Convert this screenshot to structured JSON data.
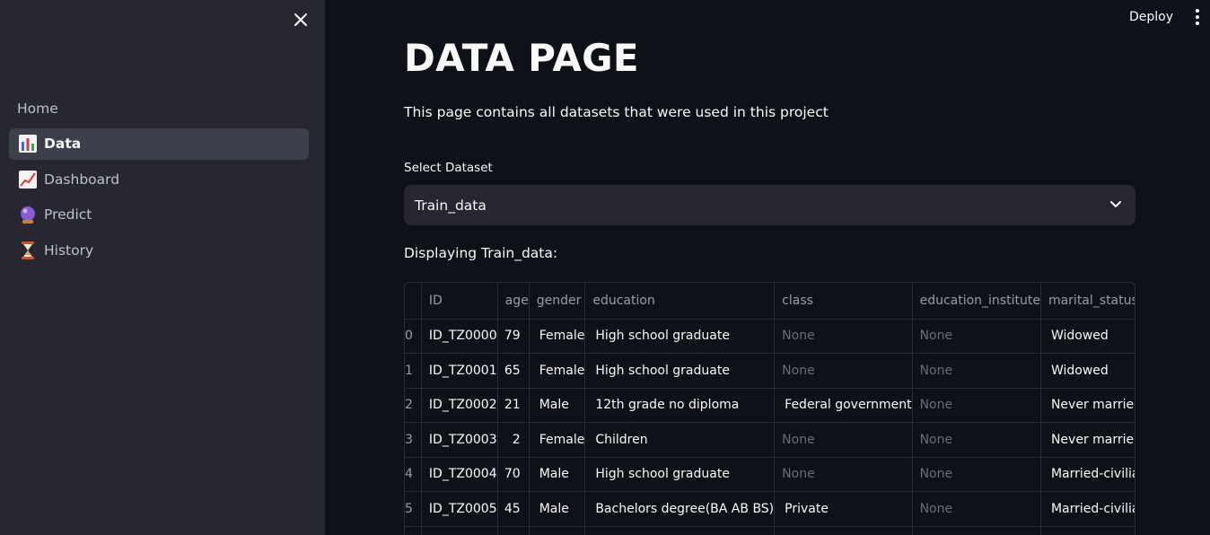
{
  "sidebar": {
    "items": [
      {
        "label": "Home",
        "icon": "",
        "active": false
      },
      {
        "label": "Data",
        "icon": "bar-chart-icon",
        "active": true
      },
      {
        "label": "Dashboard",
        "icon": "trend-chart-icon",
        "active": false
      },
      {
        "label": "Predict",
        "icon": "crystal-ball-icon",
        "active": false
      },
      {
        "label": "History",
        "icon": "hourglass-icon",
        "active": false
      }
    ]
  },
  "header": {
    "deploy_label": "Deploy"
  },
  "main": {
    "title": "DATA PAGE",
    "description": "This page contains all datasets that were used in this project",
    "select_label": "Select Dataset",
    "select_value": "Train_data",
    "displaying": "Displaying Train_data:"
  },
  "table": {
    "columns": [
      "",
      "ID",
      "age",
      "gender",
      "education",
      "class",
      "education_institute",
      "marital_status"
    ],
    "rows": [
      [
        "0",
        "ID_TZ0000",
        "79",
        "Female",
        "High school graduate",
        "None",
        "None",
        "Widowed"
      ],
      [
        "1",
        "ID_TZ0001",
        "65",
        "Female",
        "High school graduate",
        "None",
        "None",
        "Widowed"
      ],
      [
        "2",
        "ID_TZ0002",
        "21",
        "Male",
        "12th grade no diploma",
        "Federal government",
        "None",
        "Never married"
      ],
      [
        "3",
        "ID_TZ0003",
        "2",
        "Female",
        "Children",
        "None",
        "None",
        "Never married"
      ],
      [
        "4",
        "ID_TZ0004",
        "70",
        "Male",
        "High school graduate",
        "None",
        "None",
        "Married-civilian spouse present"
      ],
      [
        "5",
        "ID_TZ0005",
        "45",
        "Male",
        "Bachelors degree(BA AB BS)",
        "Private",
        "None",
        "Married-civilian spouse present"
      ],
      [
        "",
        "",
        "",
        "",
        "",
        "",
        "",
        ""
      ]
    ]
  }
}
